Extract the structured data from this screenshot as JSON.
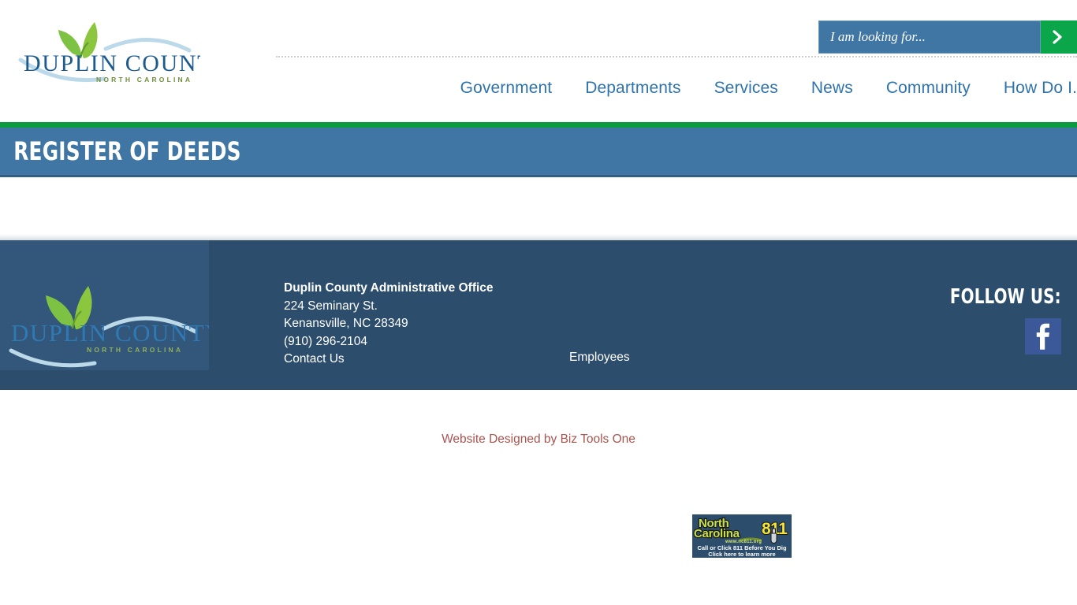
{
  "header": {
    "logo": {
      "name": "duplin-county-logo",
      "title": "DUPLIN COUNTY",
      "subtitle": "NORTH CAROLINA"
    },
    "search": {
      "placeholder": "I am looking for...",
      "value": "",
      "submit_icon": "chevron-right-icon",
      "submit_color": "#0ca64a"
    },
    "nav": [
      {
        "label": "Government"
      },
      {
        "label": "Departments"
      },
      {
        "label": "Services"
      },
      {
        "label": "News"
      },
      {
        "label": "Community"
      },
      {
        "label": "How Do I."
      }
    ]
  },
  "banner": {
    "title": "REGISTER OF DEEDS",
    "bar_color": "#0b9b41",
    "background": "#3f76a4"
  },
  "footer": {
    "logo": {
      "name": "duplin-county-logo-footer",
      "title": "DUPLIN COUNTY",
      "subtitle": "NORTH CAROLINA"
    },
    "address": {
      "office": "Duplin County Administrative Office",
      "street": "224 Seminary St.",
      "city_state_zip": "Kenansville, NC  28349",
      "phone": "(910) 296-2104",
      "contact_link": "Contact Us"
    },
    "employees_link": "Employees",
    "nc811": {
      "line1": "North",
      "line2": "Carolina",
      "number": "811",
      "url_text": "www.nc811.org",
      "caption1": "Call or Click 811 Before You Dig",
      "caption2": "Click here to learn more"
    },
    "follow": {
      "label": "FOLLOW US:",
      "facebook_icon": "facebook-icon",
      "facebook_color": "#3b5998"
    },
    "background": "#2c4d6b"
  },
  "bottom": {
    "credit": "Website Designed by Biz Tools One",
    "credit_color": "#a8554f"
  }
}
